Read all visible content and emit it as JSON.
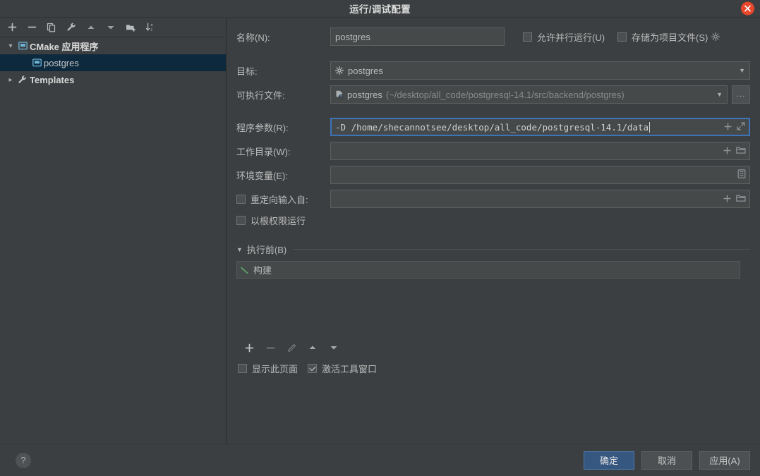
{
  "window": {
    "title": "运行/调试配置",
    "close_icon": "close-icon"
  },
  "sidebar": {
    "toolbar": [
      {
        "name": "add-configuration-button",
        "icon": "plus-icon",
        "label": "+"
      },
      {
        "name": "remove-configuration-button",
        "icon": "minus-icon",
        "label": "−"
      },
      {
        "name": "copy-configuration-button",
        "icon": "copy-icon",
        "label": "copy"
      },
      {
        "name": "edit-templates-button",
        "icon": "wrench-icon",
        "label": "wrench"
      },
      {
        "name": "move-up-button",
        "icon": "arrow-up-icon",
        "label": "up"
      },
      {
        "name": "move-down-button",
        "icon": "arrow-down-icon",
        "label": "down"
      },
      {
        "name": "new-folder-button",
        "icon": "folder-add-icon",
        "label": "folder"
      },
      {
        "name": "sort-configurations-button",
        "icon": "sort-az-icon",
        "label": "sort"
      }
    ],
    "tree": [
      {
        "label": "CMake 应用程序",
        "icon": "application-icon",
        "expanded": true,
        "selected": false,
        "level": 0
      },
      {
        "label": "postgres",
        "icon": "application-icon",
        "expanded": false,
        "selected": true,
        "level": 1
      },
      {
        "label": "Templates",
        "icon": "wrench-icon",
        "expanded": false,
        "selected": false,
        "level": 0
      }
    ]
  },
  "form": {
    "name_label": "名称(N):",
    "name_value": "postgres",
    "allow_parallel_label": "允许并行运行(U)",
    "allow_parallel_checked": false,
    "store_as_project_file_label": "存储为项目文件(S)",
    "store_as_project_file_checked": false,
    "store_gear_icon": "gear-icon",
    "target_label": "目标:",
    "target_value": "postgres",
    "target_icon": "gear-icon",
    "executable_label": "可执行文件:",
    "executable_value": "postgres",
    "executable_path": "(~/desktop/all_code/postgresql-14.1/src/backend/postgres)",
    "executable_icon": "file-unknown-icon",
    "browse_label": "...",
    "program_args_label": "程序参数(R):",
    "program_args_value": "-D /home/shecannotsee/desktop/all_code/postgresql-14.1/data",
    "program_args_focused": true,
    "working_dir_label": "工作目录(W):",
    "working_dir_value": "",
    "env_vars_label": "环境变量(E):",
    "env_vars_value": "",
    "redirect_input_label": "重定向输入自:",
    "redirect_input_checked": false,
    "redirect_input_value": "",
    "run_as_root_label": "以根权限运行",
    "run_as_root_checked": false
  },
  "before_launch": {
    "section_label": "执行前(B)",
    "expanded": true,
    "tasks": [
      {
        "label": "构建",
        "icon": "build-hammer-icon"
      }
    ],
    "toolbar": [
      {
        "name": "add-task-button",
        "icon": "plus-icon",
        "enabled": true
      },
      {
        "name": "remove-task-button",
        "icon": "minus-icon",
        "enabled": false
      },
      {
        "name": "edit-task-button",
        "icon": "pencil-icon",
        "enabled": false
      },
      {
        "name": "move-task-up-button",
        "icon": "arrow-up-icon",
        "enabled": true
      },
      {
        "name": "move-task-down-button",
        "icon": "arrow-down-icon",
        "enabled": true
      }
    ],
    "show_page_label": "显示此页面",
    "show_page_checked": false,
    "activate_tool_window_label": "激活工具窗口",
    "activate_tool_window_checked": true
  },
  "footer": {
    "help_label": "?",
    "ok_label": "确定",
    "cancel_label": "取消",
    "apply_label": "应用(A)"
  },
  "colors": {
    "background": "#3c3f41",
    "field": "#45494a",
    "accent_blue": "#365880",
    "focus_border": "#3d74b8",
    "selection": "#0d293e",
    "close_red": "#e8472b",
    "build_green": "#4f9a57"
  }
}
